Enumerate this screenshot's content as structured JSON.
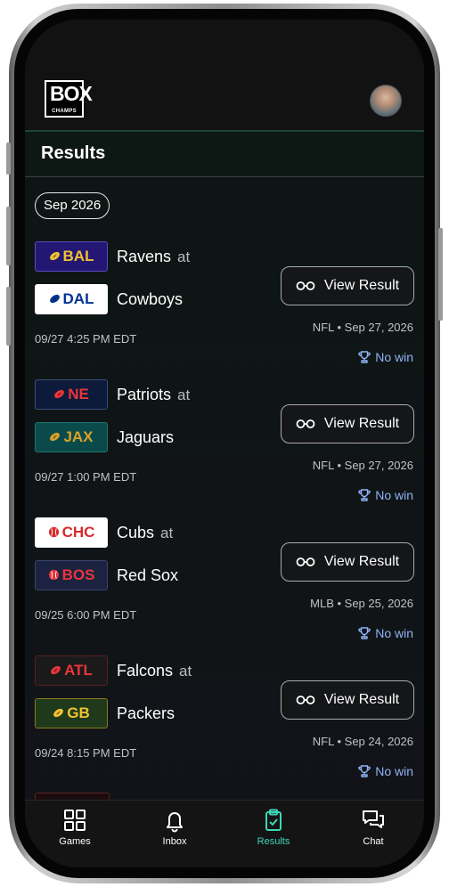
{
  "header": {
    "logo_main": "BOX",
    "logo_sub": "CHAMPS"
  },
  "page": {
    "title": "Results",
    "month": "Sep 2026"
  },
  "games": [
    {
      "away": {
        "abbr": "BAL",
        "name": "Ravens",
        "icon": "football-icon",
        "bg": "#241773",
        "fg": "#f1c232",
        "border": "#5a4bbf"
      },
      "at": "at",
      "home": {
        "abbr": "DAL",
        "name": "Cowboys",
        "icon": "football-icon",
        "bg": "#ffffff",
        "fg": "#003594",
        "border": "#ffffff"
      },
      "time": "09/27 4:25 PM EDT",
      "button": "View Result",
      "league": "NFL • Sep 27, 2026",
      "result": "No win"
    },
    {
      "away": {
        "abbr": "NE",
        "name": "Patriots",
        "icon": "football-icon",
        "bg": "#0d1a3a",
        "fg": "#e8353b",
        "border": "#3a4c7a"
      },
      "at": "at",
      "home": {
        "abbr": "JAX",
        "name": "Jaguars",
        "icon": "football-icon",
        "bg": "#0b4a4a",
        "fg": "#d7a22a",
        "border": "#1f7373"
      },
      "time": "09/27 1:00 PM EDT",
      "button": "View Result",
      "league": "NFL • Sep 27, 2026",
      "result": "No win"
    },
    {
      "away": {
        "abbr": "CHC",
        "name": "Cubs",
        "icon": "baseball-icon",
        "bg": "#ffffff",
        "fg": "#d92b2b",
        "border": "#ffffff"
      },
      "at": "at",
      "home": {
        "abbr": "BOS",
        "name": "Red Sox",
        "icon": "baseball-icon",
        "bg": "#1b2340",
        "fg": "#e8353b",
        "border": "#3a4570"
      },
      "time": "09/25 6:00 PM EDT",
      "button": "View Result",
      "league": "MLB • Sep 25, 2026",
      "result": "No win"
    },
    {
      "away": {
        "abbr": "ATL",
        "name": "Falcons",
        "icon": "football-icon",
        "bg": "#1a1a1a",
        "fg": "#e8353b",
        "border": "#5a2020"
      },
      "at": "at",
      "home": {
        "abbr": "GB",
        "name": "Packers",
        "icon": "football-icon",
        "bg": "#1e3a1a",
        "fg": "#f1c232",
        "border": "#8a7a20"
      },
      "time": "09/24 8:15 PM EDT",
      "button": "View Result",
      "league": "NFL • Sep 24, 2026",
      "result": "No win"
    }
  ],
  "nav": [
    {
      "label": "Games",
      "icon": "grid-icon",
      "active": false
    },
    {
      "label": "Inbox",
      "icon": "bell-icon",
      "active": false
    },
    {
      "label": "Results",
      "icon": "clipboard-check-icon",
      "active": true
    },
    {
      "label": "Chat",
      "icon": "chat-bubbles-icon",
      "active": false
    }
  ],
  "colors": {
    "accent": "#3fd6b8",
    "result_link": "#8fb3f5",
    "divider": "#1f4436"
  }
}
